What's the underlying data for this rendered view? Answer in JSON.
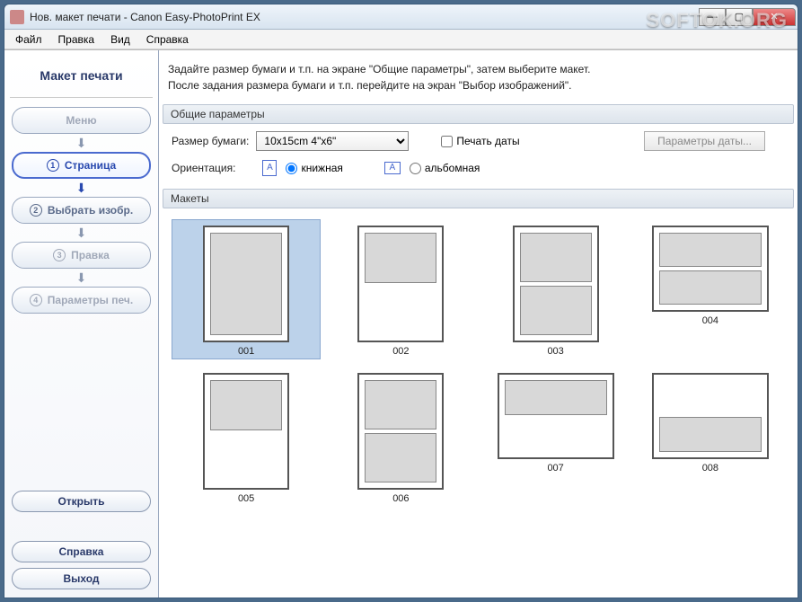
{
  "window": {
    "title": "Нов. макет печати - Canon Easy-PhotoPrint EX"
  },
  "menubar": {
    "file": "Файл",
    "edit": "Правка",
    "view": "Вид",
    "help": "Справка"
  },
  "sidebar": {
    "title": "Макет печати",
    "menu": "Меню",
    "steps": {
      "s1": "Страница",
      "s2": "Выбрать изобр.",
      "s3": "Правка",
      "s4": "Параметры печ."
    },
    "open": "Открыть",
    "help": "Справка",
    "exit": "Выход"
  },
  "instruction": {
    "line1": "Задайте размер бумаги и т.п. на экране \"Общие параметры\", затем выберите макет.",
    "line2": "После задания размера бумаги и т.п. перейдите на экран \"Выбор изображений\"."
  },
  "params": {
    "group_title": "Общие параметры",
    "paper_label": "Размер бумаги:",
    "paper_value": "10x15cm 4\"x6\"",
    "print_date": "Печать даты",
    "date_params_btn": "Параметры даты...",
    "orientation_label": "Ориентация:",
    "portrait": "книжная",
    "landscape": "альбомная"
  },
  "layouts": {
    "group_title": "Макеты",
    "items": [
      {
        "id": "001",
        "orientation": "portrait",
        "cells": [
          "fill"
        ]
      },
      {
        "id": "002",
        "orientation": "portrait",
        "cells": [
          "fill",
          "empty"
        ]
      },
      {
        "id": "003",
        "orientation": "portrait",
        "cells": [
          "fill",
          "fill"
        ]
      },
      {
        "id": "004",
        "orientation": "landscape",
        "cells": [
          "fill",
          "fill"
        ]
      },
      {
        "id": "005",
        "orientation": "portrait",
        "cells": [
          "fill",
          "empty"
        ]
      },
      {
        "id": "006",
        "orientation": "portrait",
        "cells": [
          "fill",
          "fill"
        ]
      },
      {
        "id": "007",
        "orientation": "landscape",
        "cells": [
          "fill",
          "empty"
        ]
      },
      {
        "id": "008",
        "orientation": "landscape",
        "cells": [
          "empty",
          "fill"
        ]
      }
    ],
    "selected": "001"
  },
  "watermark": "SOFTOK.ORG"
}
